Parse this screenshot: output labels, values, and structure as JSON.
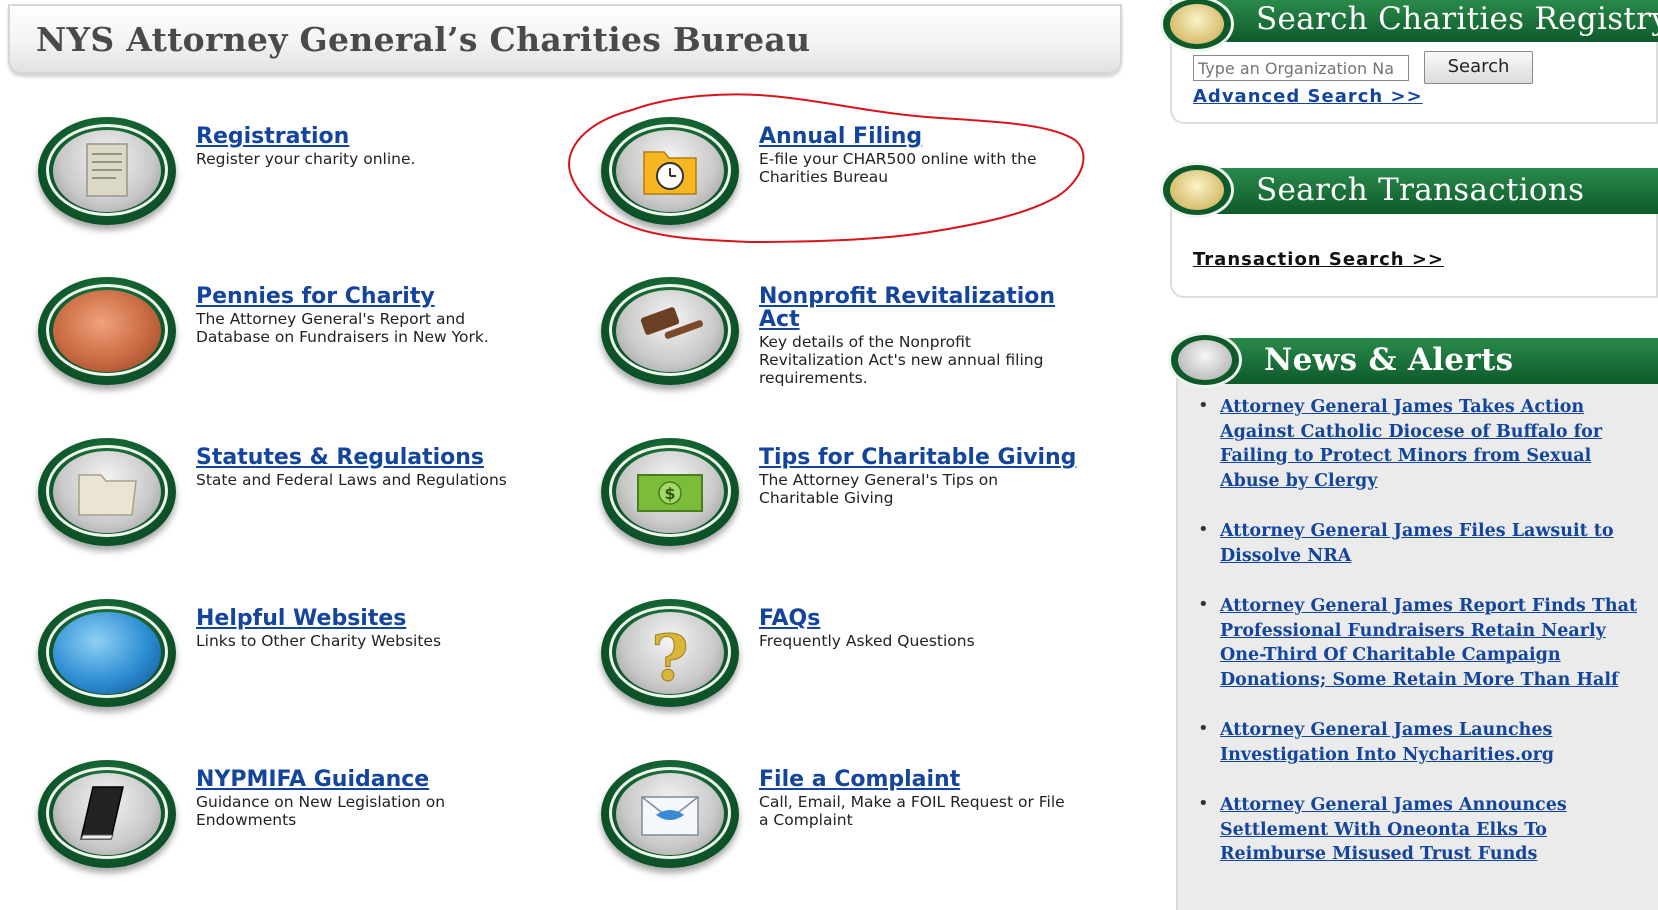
{
  "banner": {
    "title": "NYS Attorney General’s Charities Bureau"
  },
  "tiles": [
    {
      "title": "Registration",
      "desc": "Register your charity online.",
      "icon": "scroll-icon"
    },
    {
      "title": "Annual Filing",
      "desc": "E-file your CHAR500 online with the Charities Bureau",
      "icon": "folder-clock-icon"
    },
    {
      "title": "Pennies for Charity",
      "desc": "The Attorney General's Report and Database on Fundraisers in New York.",
      "icon": "penny-icon"
    },
    {
      "title": "Nonprofit Revitalization Act",
      "desc": "Key details of the Nonprofit Revitalization Act's new annual filing requirements.",
      "icon": "gavel-icon"
    },
    {
      "title": "Statutes & Regulations",
      "desc": "State and Federal Laws and Regulations",
      "icon": "folder-icon"
    },
    {
      "title": "Tips for Charitable Giving",
      "desc": "The Attorney General's Tips on Charitable Giving",
      "icon": "money-icon"
    },
    {
      "title": "Helpful Websites",
      "desc": "Links to Other Charity Websites",
      "icon": "globe-icon"
    },
    {
      "title": "FAQs",
      "desc": "Frequently Asked Questions",
      "icon": "question-mark-icon"
    },
    {
      "title": "NYPMIFA Guidance",
      "desc": "Guidance on New Legislation on Endowments",
      "icon": "book-icon"
    },
    {
      "title": "File a Complaint",
      "desc": "Call, Email, Make a FOIL Request or File a Complaint",
      "icon": "envelope-icon"
    }
  ],
  "search_registry": {
    "title": "Search Charities Registry",
    "placeholder": "Type an Organization Na",
    "button": "Search",
    "advanced": "Advanced Search >>"
  },
  "search_transactions": {
    "title": "Search Transactions",
    "link": "Transaction Search >>"
  },
  "news": {
    "title": "News & Alerts",
    "items": [
      "Attorney General James Takes Action Against Catholic Diocese of Buffalo for Failing to Protect Minors from Sexual Abuse by Clergy",
      "Attorney General James Files Lawsuit to Dissolve NRA",
      "Attorney General James Report Finds That Professional Fundraisers Retain Nearly One-Third Of Charitable Campaign Donations; Some Retain More Than Half",
      "Attorney General James Launches Investigation Into Nycharities.org",
      "Attorney General James Announces Settlement With Oneonta Elks To Reimburse Misused Trust Funds"
    ]
  },
  "colors": {
    "brand_green": "#0e5a2b",
    "link_blue": "#14459c",
    "highlight_red": "#d9141b"
  }
}
